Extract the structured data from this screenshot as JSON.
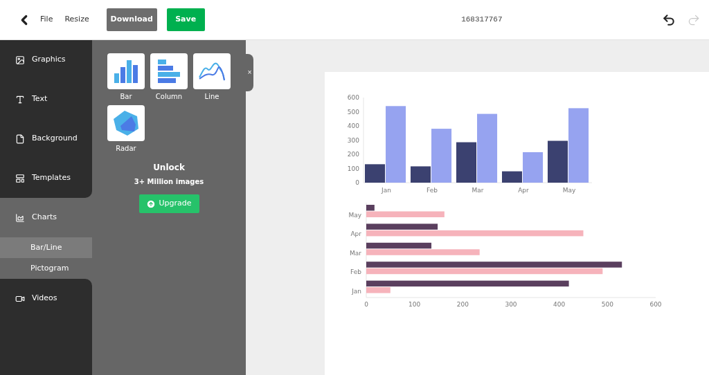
{
  "toolbar": {
    "file_menu": "File",
    "resize_menu": "Resize",
    "download_button": "Download",
    "save_button": "Save",
    "document_title": "168317767",
    "undo": {
      "disabled": false
    },
    "redo": {
      "disabled": true
    }
  },
  "sidebar": {
    "items": [
      {
        "label": "Graphics",
        "selected": false
      },
      {
        "label": "Text",
        "selected": false
      },
      {
        "label": "Background",
        "selected": false
      },
      {
        "label": "Templates",
        "selected": false
      },
      {
        "label": "Charts",
        "selected": true,
        "children": [
          {
            "label": "Bar/Line",
            "selected": true
          },
          {
            "label": "Pictogram",
            "selected": false
          }
        ]
      },
      {
        "label": "Videos",
        "selected": false
      }
    ]
  },
  "panel": {
    "close": "×",
    "chart_types": [
      {
        "label": "Bar"
      },
      {
        "label": "Column"
      },
      {
        "label": "Line"
      },
      {
        "label": "Radar"
      }
    ],
    "unlock_title": "Unlock",
    "unlock_subtitle": "3+ Million images",
    "upgrade_button": "Upgrade"
  },
  "canvas": {
    "charts": [
      {
        "chart_data": {
          "type": "bar",
          "orientation": "vertical",
          "categories": [
            "Jan",
            "Feb",
            "Mar",
            "Apr",
            "May"
          ],
          "ylim": [
            0,
            600
          ],
          "yticks": [
            0,
            100,
            200,
            300,
            400,
            500,
            600
          ],
          "series": [
            {
              "color": "#3b4170",
              "values": [
                130,
                115,
                285,
                80,
                295
              ]
            },
            {
              "color": "#96a3f0",
              "values": [
                540,
                380,
                485,
                215,
                525
              ]
            }
          ]
        }
      },
      {
        "chart_data": {
          "type": "bar",
          "orientation": "horizontal",
          "categories": [
            "May",
            "Apr",
            "Mar",
            "Feb",
            "Jan"
          ],
          "xlim": [
            0,
            600
          ],
          "xticks": [
            0,
            100,
            200,
            300,
            400,
            500,
            600
          ],
          "series": [
            {
              "color": "#5a3f5e",
              "values": [
                17,
                148,
                135,
                530,
                420
              ]
            },
            {
              "color": "#f6b3bb",
              "values": [
                162,
                450,
                235,
                490,
                50
              ]
            }
          ]
        }
      }
    ]
  }
}
